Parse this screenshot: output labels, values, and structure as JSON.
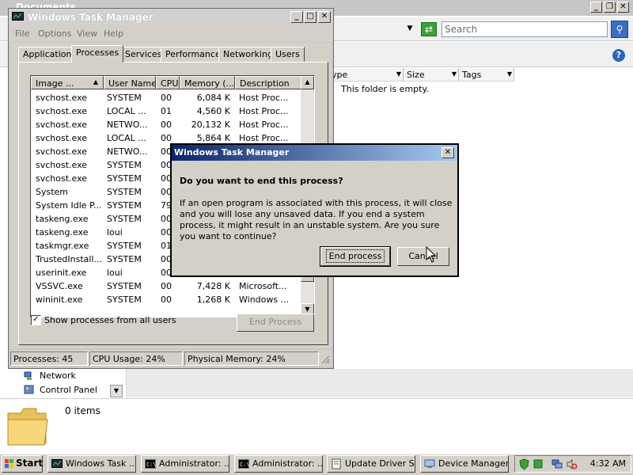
{
  "explorer": {
    "title": "Documents",
    "search_placeholder": "Search",
    "columns": [
      "Type",
      "Size",
      "Tags"
    ],
    "empty_text": "This folder is empty.",
    "nav_items": [
      "Network",
      "Control Panel"
    ],
    "item_count": "0 items"
  },
  "task_manager": {
    "title": "Windows Task Manager",
    "menu": [
      "File",
      "Options",
      "View",
      "Help"
    ],
    "tabs": [
      "Applications",
      "Processes",
      "Services",
      "Performance",
      "Networking",
      "Users"
    ],
    "active_tab": "Processes",
    "columns": [
      "Image ...",
      "User Name",
      "CPU",
      "Memory (...",
      "Description"
    ],
    "processes": [
      {
        "image": "svchost.exe",
        "user": "SYSTEM",
        "cpu": "00",
        "memory": "6,084 K",
        "description": "Host Proc..."
      },
      {
        "image": "svchost.exe",
        "user": "LOCAL ...",
        "cpu": "01",
        "memory": "4,560 K",
        "description": "Host Proc..."
      },
      {
        "image": "svchost.exe",
        "user": "NETWO...",
        "cpu": "00",
        "memory": "20,132 K",
        "description": "Host Proc..."
      },
      {
        "image": "svchost.exe",
        "user": "LOCAL ...",
        "cpu": "00",
        "memory": "5,864 K",
        "description": "Host Proc..."
      },
      {
        "image": "svchost.exe",
        "user": "NETWO...",
        "cpu": "00",
        "memory": "",
        "description": ""
      },
      {
        "image": "svchost.exe",
        "user": "SYSTEM",
        "cpu": "00",
        "memory": "",
        "description": ""
      },
      {
        "image": "svchost.exe",
        "user": "SYSTEM",
        "cpu": "00",
        "memory": "",
        "description": ""
      },
      {
        "image": "System",
        "user": "SYSTEM",
        "cpu": "00",
        "memory": "",
        "description": ""
      },
      {
        "image": "System Idle P...",
        "user": "SYSTEM",
        "cpu": "79",
        "memory": "",
        "description": ""
      },
      {
        "image": "taskeng.exe",
        "user": "SYSTEM",
        "cpu": "00",
        "memory": "",
        "description": ""
      },
      {
        "image": "taskeng.exe",
        "user": "loui",
        "cpu": "00",
        "memory": "",
        "description": ""
      },
      {
        "image": "taskmgr.exe",
        "user": "SYSTEM",
        "cpu": "01",
        "memory": "",
        "description": ""
      },
      {
        "image": "TrustedInstall...",
        "user": "SYSTEM",
        "cpu": "00",
        "memory": "",
        "description": ""
      },
      {
        "image": "userinit.exe",
        "user": "loui",
        "cpu": "00",
        "memory": "",
        "description": ""
      },
      {
        "image": "VSSVC.exe",
        "user": "SYSTEM",
        "cpu": "00",
        "memory": "7,428 K",
        "description": "Microsoft..."
      },
      {
        "image": "wininit.exe",
        "user": "SYSTEM",
        "cpu": "00",
        "memory": "1,268 K",
        "description": "Windows ..."
      }
    ],
    "show_all_label": "Show processes from all users",
    "show_all_checked": "✓",
    "end_process_label": "End Process",
    "status": {
      "processes": "Processes: 45",
      "cpu": "CPU Usage: 24%",
      "memory": "Physical Memory: 24%"
    }
  },
  "dialog": {
    "title": "Windows Task Manager",
    "question": "Do you want to end this process?",
    "message": "If an open program is associated with this process, it will close and you will lose any unsaved data. If you end a system process, it might result in an unstable system. Are you sure you want to continue?",
    "confirm_label": "End process",
    "cancel_label": "Cancel"
  },
  "taskbar": {
    "start_label": "Start",
    "buttons": [
      "Windows Task ...",
      "Administrator: ...",
      "Administrator: ...",
      "Update Driver S...",
      "Device Manager"
    ],
    "clock": "4:32 AM"
  }
}
